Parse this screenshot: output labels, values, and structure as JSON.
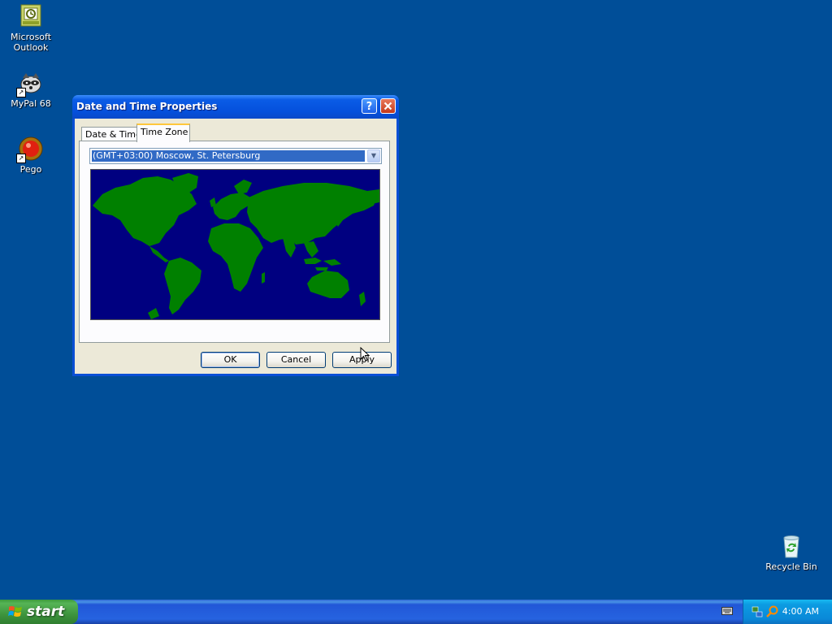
{
  "desktop": {
    "icons": [
      {
        "label": "Microsoft\nOutlook",
        "icon": "outlook-icon"
      },
      {
        "label": "MyPal 68",
        "icon": "raccoon-icon"
      },
      {
        "label": "Pego",
        "icon": "pego-icon"
      },
      {
        "label": "Recycle Bin",
        "icon": "recycle-bin-icon"
      }
    ],
    "background_color": "#004e98"
  },
  "dialog": {
    "title": "Date and Time Properties",
    "help_label": "?",
    "close_label": "✕",
    "tabs": [
      {
        "label": "Date & Time",
        "active": false
      },
      {
        "label": "Time Zone",
        "active": true
      }
    ],
    "timezone": {
      "selected": "(GMT+03:00) Moscow, St. Petersburg"
    },
    "map": {
      "ocean_color": "#000080",
      "land_color": "#008000"
    },
    "buttons": {
      "ok": "OK",
      "cancel": "Cancel",
      "apply": "Apply"
    }
  },
  "taskbar": {
    "start_label": "start",
    "clock": "4:00 AM"
  }
}
